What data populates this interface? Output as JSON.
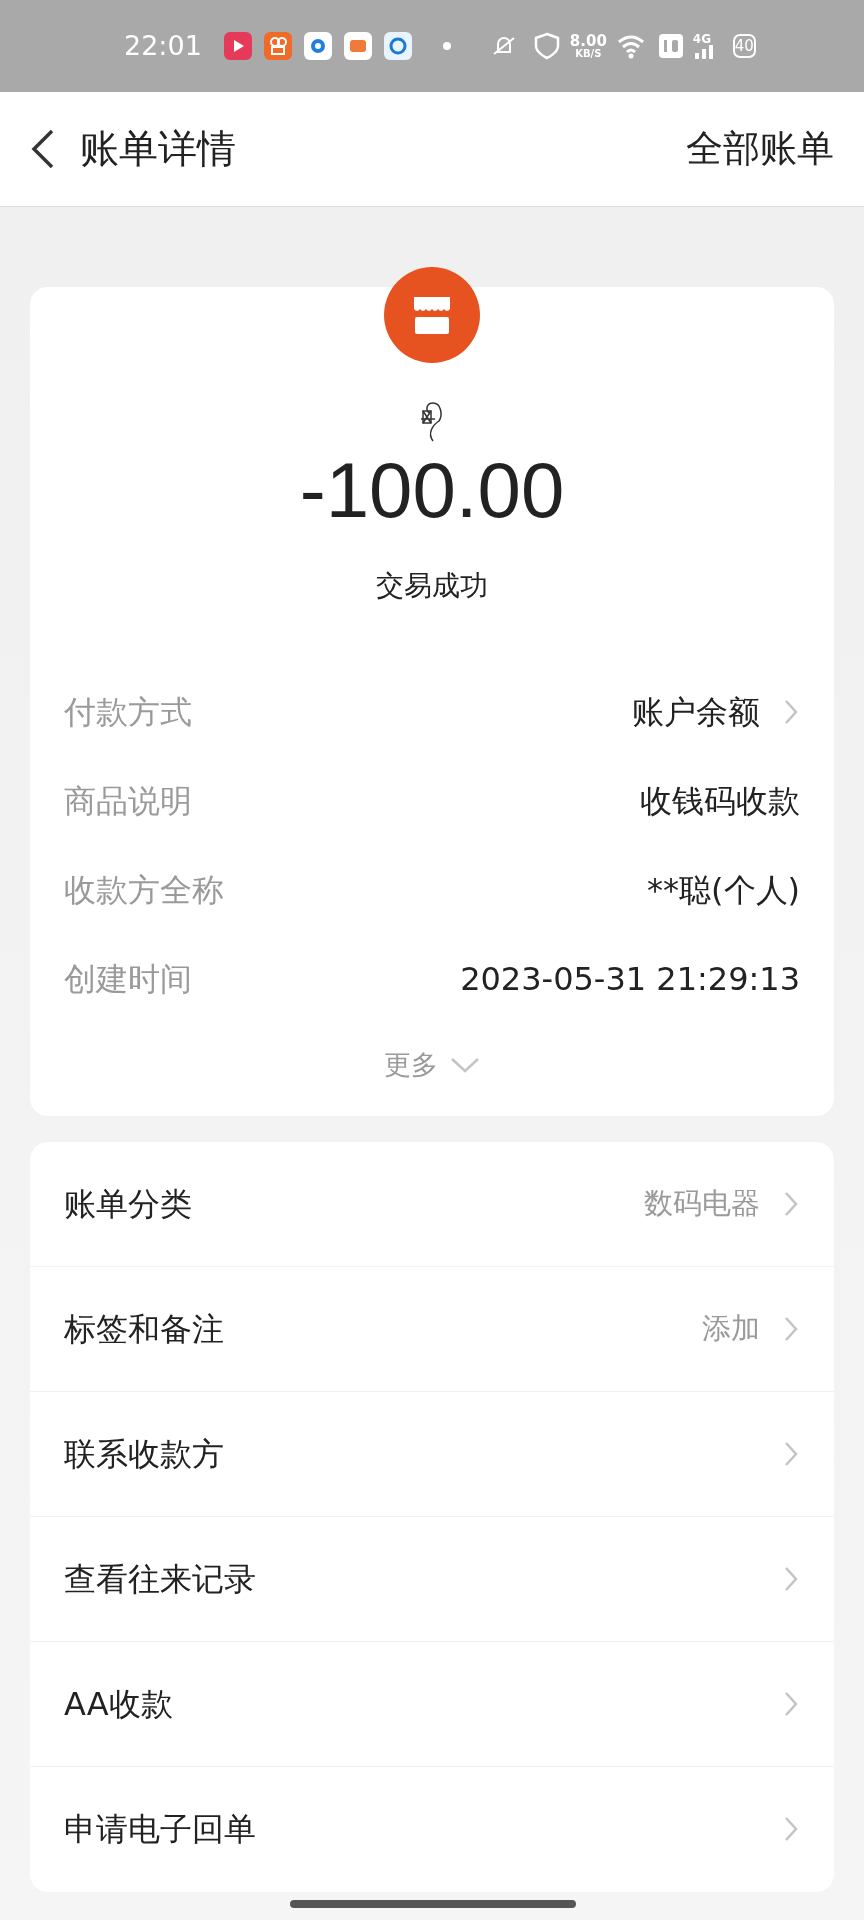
{
  "status_bar": {
    "time": "22:01",
    "speed": "8.00",
    "speed_unit": "KB/S",
    "network": "4G",
    "battery": "40"
  },
  "header": {
    "title": "账单详情",
    "action": "全部账单"
  },
  "summary": {
    "amount": "-100.00",
    "status": "交易成功"
  },
  "details": [
    {
      "label": "付款方式",
      "value": "账户余额",
      "chevron": true
    },
    {
      "label": "商品说明",
      "value": "收钱码收款",
      "chevron": false
    },
    {
      "label": "收款方全称",
      "value": "**聪(个人)",
      "chevron": false
    },
    {
      "label": "创建时间",
      "value": "2023-05-31 21:29:13",
      "chevron": false
    }
  ],
  "more": "更多",
  "actions": [
    {
      "label": "账单分类",
      "value": "数码电器"
    },
    {
      "label": "标签和备注",
      "value": "添加"
    },
    {
      "label": "联系收款方"
    },
    {
      "label": "查看往来记录"
    },
    {
      "label": "AA收款"
    },
    {
      "label": "申请电子回单"
    }
  ]
}
